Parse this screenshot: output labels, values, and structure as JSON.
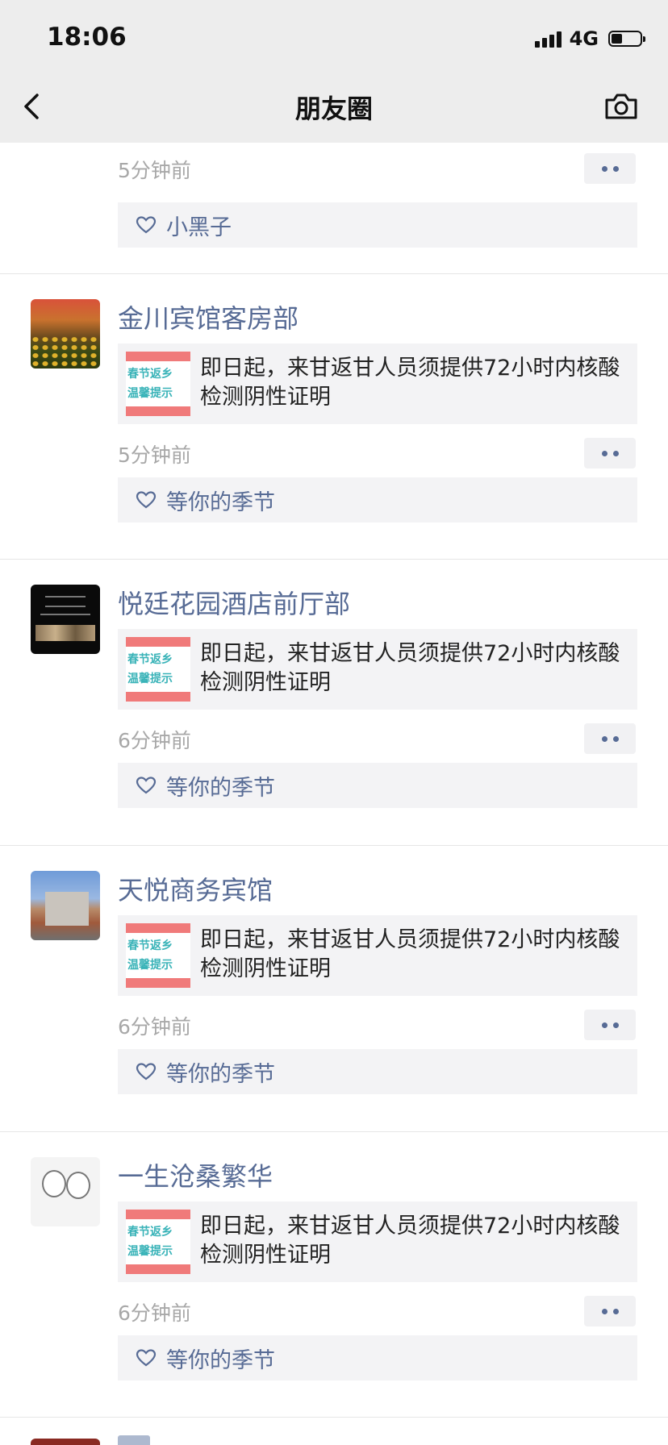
{
  "status_bar": {
    "time": "18:06",
    "network": "4G"
  },
  "nav": {
    "title": "朋友圈",
    "back_icon": "chevron-left-icon",
    "camera_icon": "camera-icon"
  },
  "top_fragment": {
    "time": "5分钟前",
    "liker": "小黑子"
  },
  "posts": [
    {
      "name": "金川宾馆客房部",
      "link_text": "即日起，来甘返甘人员须提供72小时内核酸检测阴性证明",
      "thumb_line1": "春节返乡",
      "thumb_line2": "温馨提示",
      "time": "5分钟前",
      "liker": "等你的季节"
    },
    {
      "name": "悦廷花园酒店前厅部",
      "link_text": "即日起，来甘返甘人员须提供72小时内核酸检测阴性证明",
      "thumb_line1": "春节返乡",
      "thumb_line2": "温馨提示",
      "time": "6分钟前",
      "liker": "等你的季节"
    },
    {
      "name": "天悦商务宾馆",
      "link_text": "即日起，来甘返甘人员须提供72小时内核酸检测阴性证明",
      "thumb_line1": "春节返乡",
      "thumb_line2": "温馨提示",
      "time": "6分钟前",
      "liker": "等你的季节"
    },
    {
      "name": "一生沧桑繁华",
      "link_text": "即日起，来甘返甘人员须提供72小时内核酸检测阴性证明",
      "thumb_line1": "春节返乡",
      "thumb_line2": "温馨提示",
      "time": "6分钟前",
      "liker": "等你的季节"
    }
  ],
  "colors": {
    "nickname": "#576b95",
    "header_bg": "#ededed",
    "meta_gray": "#a8a8a8"
  }
}
